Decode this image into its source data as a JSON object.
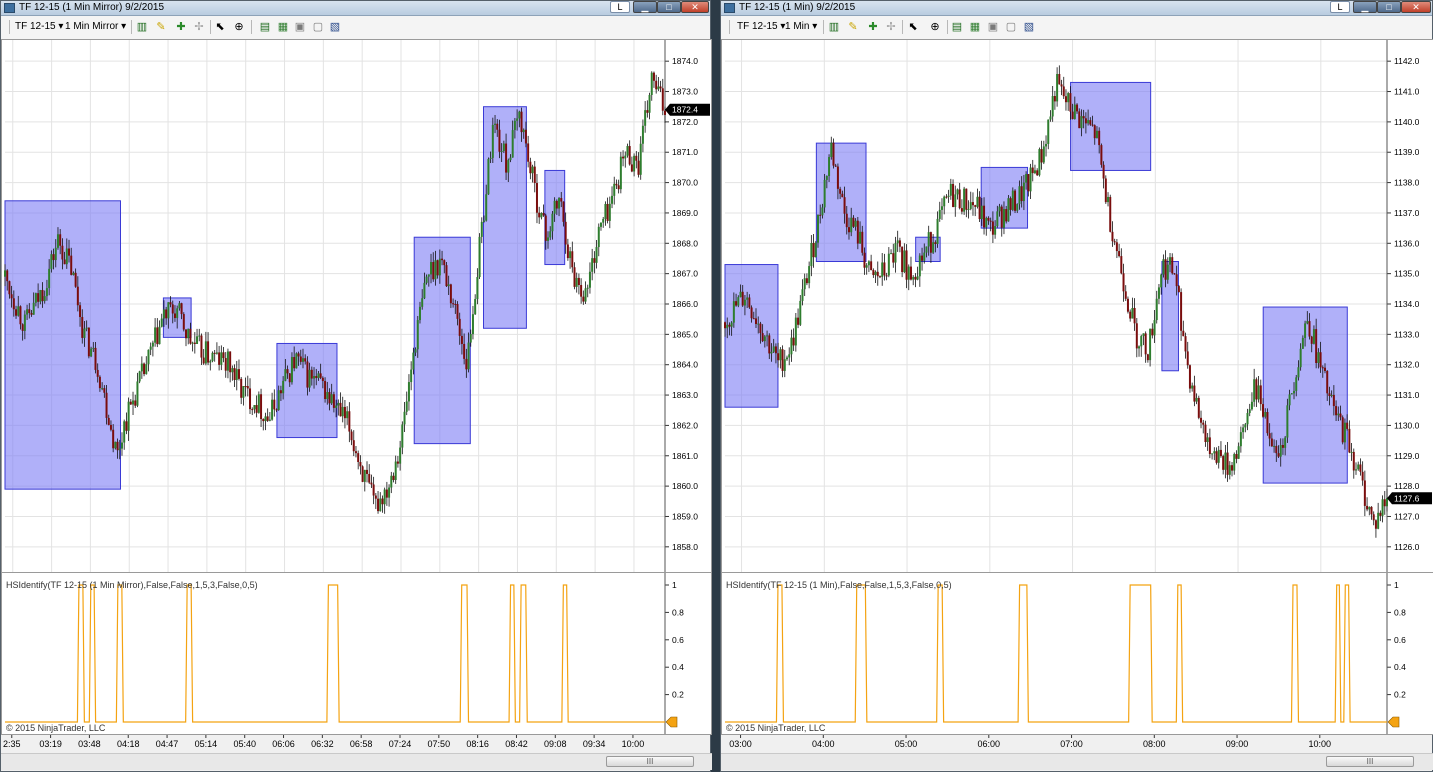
{
  "colors": {
    "box_fill": "#7b7bf5",
    "box_stroke": "#3a3ad6",
    "bull": "#2e7d2e",
    "bear": "#7a0d0d",
    "wick": "#111111",
    "indicator": "#f4a312",
    "grid": "#e3e3e3",
    "price_tag_bg": "#000000"
  },
  "windows": [
    {
      "id": "left",
      "title": "TF 12-15 (1 Min Mirror)  9/2/2015",
      "lang_button": "L",
      "toolbar": {
        "instrument": "TF 12-15",
        "period": "1 Min Mirror"
      },
      "price_axis": [
        "1874.0",
        "1873.0",
        "1872.0",
        "1871.0",
        "1870.0",
        "1869.0",
        "1868.0",
        "1867.0",
        "1866.0",
        "1865.0",
        "1864.0",
        "1863.0",
        "1862.0",
        "1861.0",
        "1860.0",
        "1859.0",
        "1858.0"
      ],
      "current_price": "1872.4",
      "time_axis": [
        "2:35",
        "03:19",
        "03:48",
        "04:18",
        "04:47",
        "05:14",
        "05:40",
        "06:06",
        "06:32",
        "06:58",
        "07:24",
        "07:50",
        "08:16",
        "08:42",
        "09:08",
        "09:34",
        "10:00"
      ],
      "indicator_label": "HSIdentify(TF 12-15 (1 Min Mirror),False,False,1,5,3,False,0,5)",
      "indicator_axis": [
        "1",
        "0.8",
        "0.6",
        "0.4",
        "0.2"
      ],
      "copyright": "© 2015 NinjaTrader, LLC",
      "scroll_thumb": "III"
    },
    {
      "id": "right",
      "title": "TF 12-15 (1 Min)  9/2/2015",
      "lang_button": "L",
      "toolbar": {
        "instrument": "TF 12-15",
        "period": "1 Min"
      },
      "price_axis": [
        "1142.0",
        "1141.0",
        "1140.0",
        "1139.0",
        "1138.0",
        "1137.0",
        "1136.0",
        "1135.0",
        "1134.0",
        "1133.0",
        "1132.0",
        "1131.0",
        "1130.0",
        "1129.0",
        "1128.0",
        "1127.0",
        "1126.0"
      ],
      "current_price": "1127.6",
      "time_axis": [
        "03:00",
        "04:00",
        "05:00",
        "06:00",
        "07:00",
        "08:00",
        "09:00",
        "10:00"
      ],
      "indicator_label": "HSIdentify(TF 12-15 (1 Min),False,False,1,5,3,False,0,5)",
      "indicator_axis": [
        "1",
        "0.8",
        "0.6",
        "0.4",
        "0.2"
      ],
      "copyright": "© 2015 NinjaTrader, LLC",
      "scroll_thumb": "III"
    }
  ],
  "chart_data": [
    {
      "type": "candlestick",
      "title": "TF 12-15 (1 Min Mirror) 9/2/2015",
      "ylim": [
        1857.5,
        1874.5
      ],
      "path": [
        [
          0,
          1866.9
        ],
        [
          0.03,
          1865.3
        ],
        [
          0.06,
          1866.6
        ],
        [
          0.08,
          1868.1
        ],
        [
          0.1,
          1867.2
        ],
        [
          0.12,
          1865.0
        ],
        [
          0.14,
          1864.0
        ],
        [
          0.16,
          1862.0
        ],
        [
          0.17,
          1861.0
        ],
        [
          0.18,
          1862.0
        ],
        [
          0.2,
          1863.2
        ],
        [
          0.22,
          1864.3
        ],
        [
          0.24,
          1865.6
        ],
        [
          0.26,
          1865.8
        ],
        [
          0.28,
          1864.8
        ],
        [
          0.3,
          1864.4
        ],
        [
          0.32,
          1864.2
        ],
        [
          0.34,
          1864.0
        ],
        [
          0.36,
          1863.1
        ],
        [
          0.38,
          1862.8
        ],
        [
          0.4,
          1862.2
        ],
        [
          0.42,
          1863.3
        ],
        [
          0.44,
          1864.2
        ],
        [
          0.46,
          1863.6
        ],
        [
          0.48,
          1863.3
        ],
        [
          0.5,
          1862.6
        ],
        [
          0.52,
          1862.0
        ],
        [
          0.54,
          1860.6
        ],
        [
          0.56,
          1859.3
        ],
        [
          0.58,
          1860.0
        ],
        [
          0.6,
          1861.5
        ],
        [
          0.62,
          1864.6
        ],
        [
          0.64,
          1867.0
        ],
        [
          0.66,
          1867.5
        ],
        [
          0.68,
          1866.0
        ],
        [
          0.7,
          1864.0
        ],
        [
          0.72,
          1868.0
        ],
        [
          0.74,
          1872.0
        ],
        [
          0.76,
          1870.6
        ],
        [
          0.78,
          1872.3
        ],
        [
          0.8,
          1870.0
        ],
        [
          0.82,
          1868.2
        ],
        [
          0.84,
          1869.5
        ],
        [
          0.86,
          1867.0
        ],
        [
          0.88,
          1866.3
        ],
        [
          0.9,
          1868.4
        ],
        [
          0.92,
          1869.5
        ],
        [
          0.94,
          1871.0
        ],
        [
          0.96,
          1870.6
        ],
        [
          0.98,
          1873.4
        ],
        [
          1,
          1872.4
        ]
      ],
      "boxes": [
        {
          "t0": 0.0,
          "t1": 0.175,
          "low": 1859.9,
          "high": 1869.4
        },
        {
          "t0": 0.24,
          "t1": 0.282,
          "low": 1864.9,
          "high": 1866.2
        },
        {
          "t0": 0.412,
          "t1": 0.503,
          "low": 1861.6,
          "high": 1864.7
        },
        {
          "t0": 0.62,
          "t1": 0.705,
          "low": 1861.4,
          "high": 1868.2
        },
        {
          "t0": 0.725,
          "t1": 0.79,
          "low": 1865.2,
          "high": 1872.5
        },
        {
          "t0": 0.818,
          "t1": 0.848,
          "low": 1867.3,
          "high": 1870.4
        }
      ],
      "indicator_pulses": [
        [
          0.112,
          0.118
        ],
        [
          0.13,
          0.135
        ],
        [
          0.171,
          0.177
        ],
        [
          0.276,
          0.282
        ],
        [
          0.49,
          0.504
        ],
        [
          0.692,
          0.7
        ],
        [
          0.766,
          0.771
        ],
        [
          0.782,
          0.789
        ],
        [
          0.846,
          0.851
        ]
      ]
    },
    {
      "type": "candlestick",
      "title": "TF 12-15 (1 Min) 9/2/2015",
      "ylim": [
        1125.5,
        1142.5
      ],
      "path": [
        [
          0,
          1133.4
        ],
        [
          0.03,
          1134.3
        ],
        [
          0.06,
          1133.0
        ],
        [
          0.08,
          1132.0
        ],
        [
          0.1,
          1132.6
        ],
        [
          0.12,
          1134.5
        ],
        [
          0.14,
          1136.6
        ],
        [
          0.16,
          1139.2
        ],
        [
          0.18,
          1137.0
        ],
        [
          0.2,
          1136.3
        ],
        [
          0.22,
          1134.8
        ],
        [
          0.24,
          1135.0
        ],
        [
          0.26,
          1135.8
        ],
        [
          0.28,
          1135.0
        ],
        [
          0.3,
          1135.6
        ],
        [
          0.32,
          1136.5
        ],
        [
          0.34,
          1137.6
        ],
        [
          0.36,
          1137.4
        ],
        [
          0.38,
          1137.2
        ],
        [
          0.4,
          1136.4
        ],
        [
          0.42,
          1137.0
        ],
        [
          0.44,
          1137.4
        ],
        [
          0.46,
          1138.0
        ],
        [
          0.48,
          1139.0
        ],
        [
          0.5,
          1141.2
        ],
        [
          0.52,
          1140.5
        ],
        [
          0.54,
          1140.0
        ],
        [
          0.56,
          1139.6
        ],
        [
          0.58,
          1137.0
        ],
        [
          0.6,
          1135.0
        ],
        [
          0.62,
          1133.0
        ],
        [
          0.64,
          1132.5
        ],
        [
          0.66,
          1135.3
        ],
        [
          0.68,
          1135.0
        ],
        [
          0.7,
          1131.8
        ],
        [
          0.72,
          1130.0
        ],
        [
          0.74,
          1129.2
        ],
        [
          0.76,
          1128.6
        ],
        [
          0.78,
          1129.4
        ],
        [
          0.8,
          1131.5
        ],
        [
          0.82,
          1130.0
        ],
        [
          0.84,
          1129.2
        ],
        [
          0.86,
          1131.6
        ],
        [
          0.88,
          1133.6
        ],
        [
          0.9,
          1131.8
        ],
        [
          0.92,
          1130.4
        ],
        [
          0.94,
          1129.6
        ],
        [
          0.96,
          1128.2
        ],
        [
          0.98,
          1126.7
        ],
        [
          1,
          1127.6
        ]
      ],
      "boxes": [
        {
          "t0": 0.0,
          "t1": 0.08,
          "low": 1130.6,
          "high": 1135.3
        },
        {
          "t0": 0.138,
          "t1": 0.213,
          "low": 1135.4,
          "high": 1139.3
        },
        {
          "t0": 0.288,
          "t1": 0.325,
          "low": 1135.4,
          "high": 1136.2
        },
        {
          "t0": 0.387,
          "t1": 0.457,
          "low": 1136.5,
          "high": 1138.5
        },
        {
          "t0": 0.522,
          "t1": 0.643,
          "low": 1138.4,
          "high": 1141.3
        },
        {
          "t0": 0.66,
          "t1": 0.685,
          "low": 1131.8,
          "high": 1135.4
        },
        {
          "t0": 0.813,
          "t1": 0.94,
          "low": 1128.1,
          "high": 1133.9
        }
      ],
      "indicator_pulses": [
        [
          0.08,
          0.086
        ],
        [
          0.199,
          0.212
        ],
        [
          0.322,
          0.328
        ],
        [
          0.445,
          0.456
        ],
        [
          0.612,
          0.643
        ],
        [
          0.684,
          0.689
        ],
        [
          0.858,
          0.864
        ],
        [
          0.924,
          0.928
        ],
        [
          0.937,
          0.942
        ]
      ]
    }
  ]
}
